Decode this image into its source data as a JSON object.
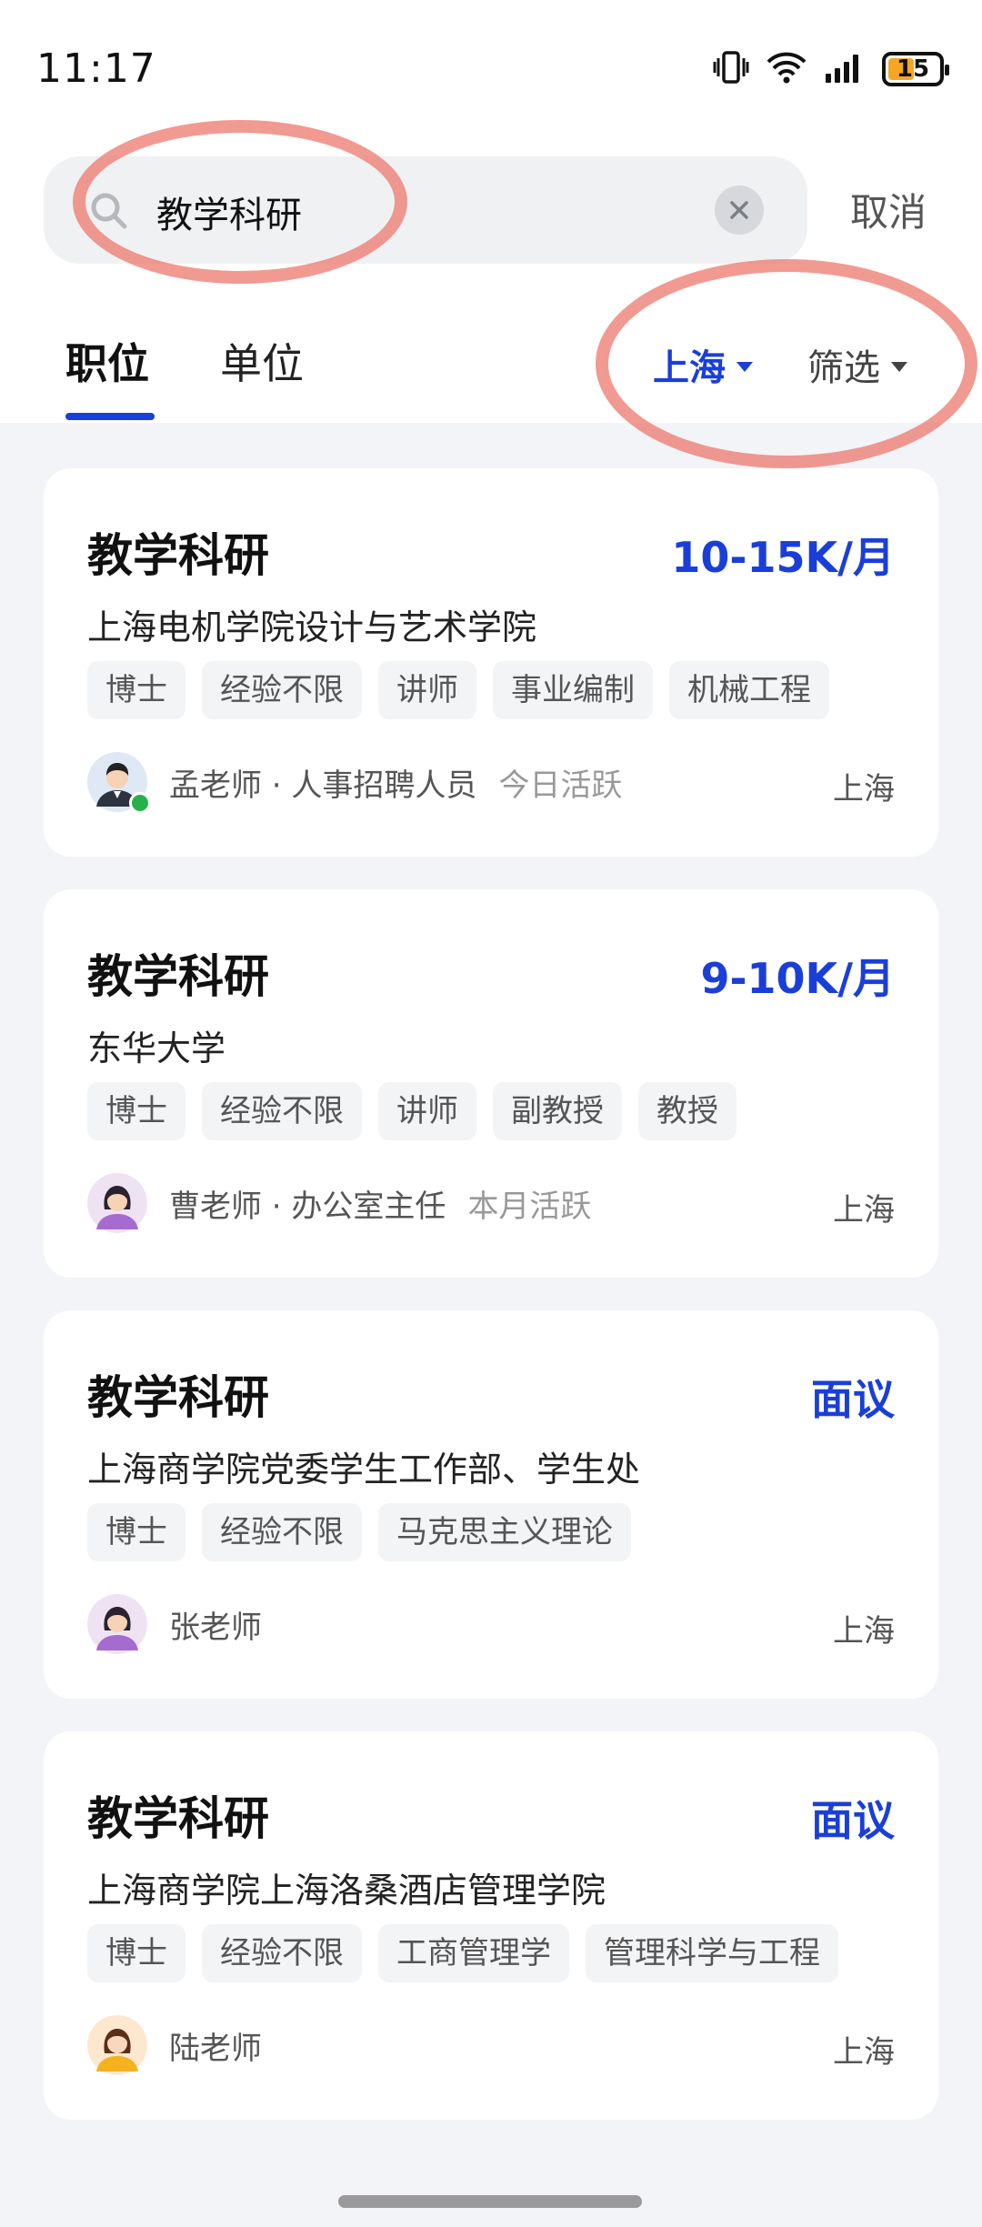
{
  "status_bar": {
    "time": "11:17",
    "battery_level": "15"
  },
  "search": {
    "query": "教学科研",
    "cancel_label": "取消"
  },
  "tabs": [
    {
      "label": "职位",
      "active": true
    },
    {
      "label": "单位",
      "active": false
    }
  ],
  "filters": {
    "city": "上海",
    "screen": "筛选"
  },
  "colors": {
    "accent": "#1a3fd8",
    "annotation_circle": "#ec786e",
    "online": "#26b24b"
  },
  "jobs": [
    {
      "title": "教学科研",
      "salary": "10-15K/月",
      "company": "上海电机学院设计与艺术学院",
      "tags": [
        "博士",
        "经验不限",
        "讲师",
        "事业编制",
        "机械工程"
      ],
      "contact": "孟老师 · 人事招聘人员",
      "activity": "今日活跃",
      "city": "上海",
      "avatar": "male-avatar"
    },
    {
      "title": "教学科研",
      "salary": "9-10K/月",
      "company": "东华大学",
      "tags": [
        "博士",
        "经验不限",
        "讲师",
        "副教授",
        "教授"
      ],
      "contact": "曹老师 · 办公室主任",
      "activity": "本月活跃",
      "city": "上海",
      "avatar": "female-avatar"
    },
    {
      "title": "教学科研",
      "salary": "面议",
      "company": "上海商学院党委学生工作部、学生处",
      "tags": [
        "博士",
        "经验不限",
        "马克思主义理论"
      ],
      "contact": "张老师",
      "activity": "",
      "city": "上海",
      "avatar": "female-avatar"
    },
    {
      "title": "教学科研",
      "salary": "面议",
      "company": "上海商学院上海洛桑酒店管理学院",
      "tags": [
        "博士",
        "经验不限",
        "工商管理学",
        "管理科学与工程"
      ],
      "contact": "陆老师",
      "activity": "",
      "city": "上海",
      "avatar": "female-avatar-orange"
    }
  ]
}
